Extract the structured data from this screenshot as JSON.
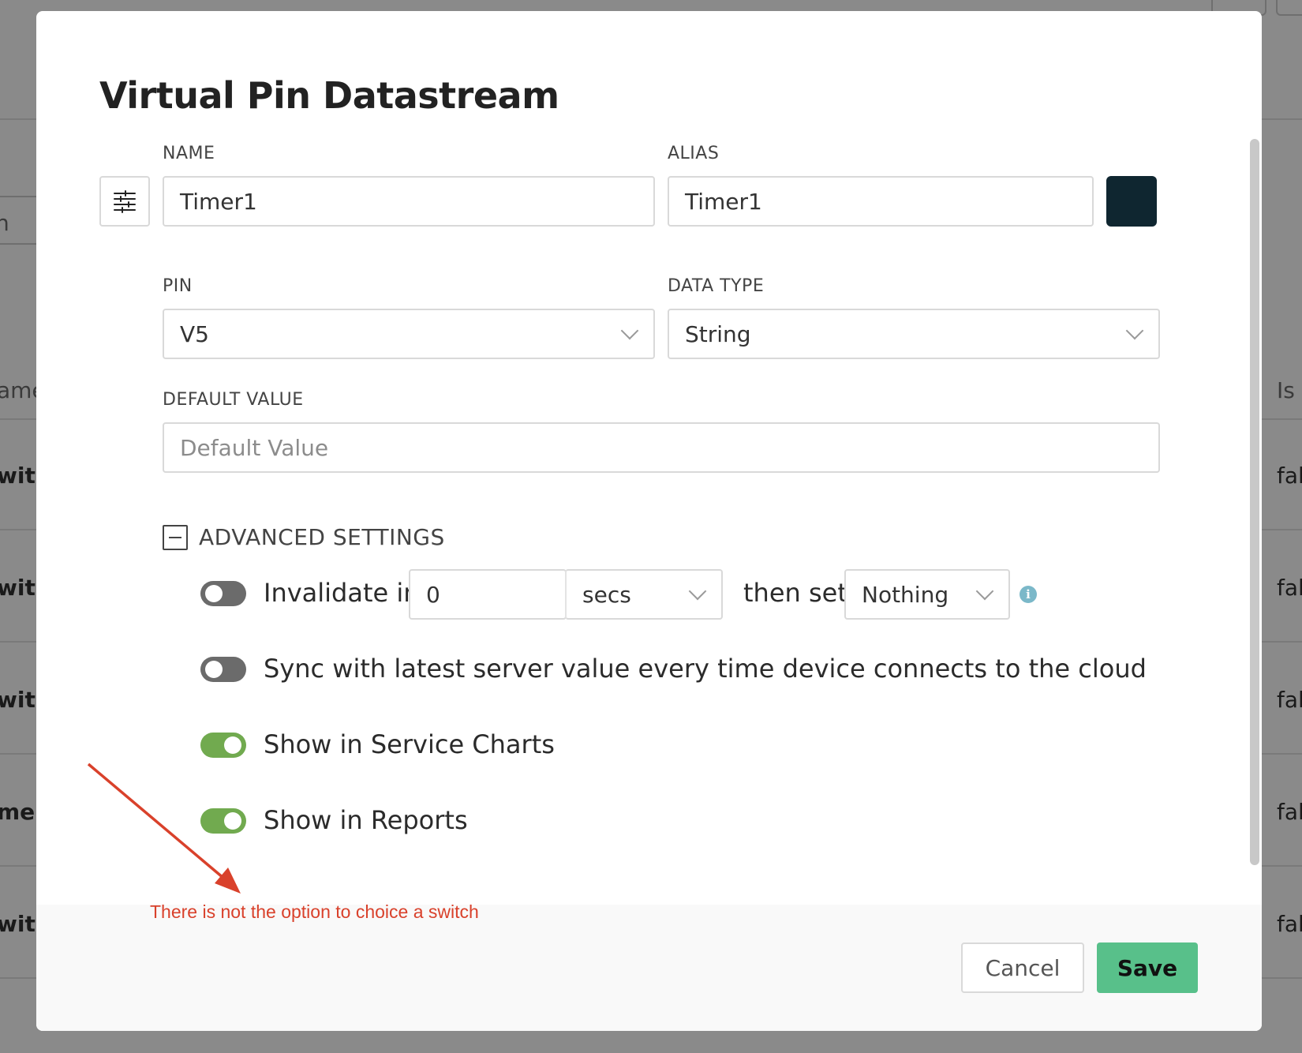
{
  "modal": {
    "title": "Virtual Pin Datastream",
    "name_label": "NAME",
    "name_value": "Timer1",
    "alias_label": "ALIAS",
    "alias_value": "Timer1",
    "color_swatch": "#0f2630",
    "pin_label": "PIN",
    "pin_value": "V5",
    "data_type_label": "DATA TYPE",
    "data_type_value": "String",
    "default_value_label": "DEFAULT VALUE",
    "default_value_placeholder": "Default Value",
    "advanced_settings_label": "ADVANCED SETTINGS"
  },
  "advanced": {
    "invalidate": {
      "enabled": false,
      "label": "Invalidate in",
      "value": "0",
      "unit": "secs",
      "then_label": "then set",
      "then_value": "Nothing"
    },
    "sync": {
      "enabled": false,
      "label": "Sync with latest server value every time device connects to the cloud"
    },
    "service_charts": {
      "enabled": true,
      "label": "Show in Service Charts"
    },
    "reports": {
      "enabled": true,
      "label": "Show in Reports"
    }
  },
  "footer": {
    "cancel_label": "Cancel",
    "save_label": "Save"
  },
  "annotation": {
    "text": "There is not the option to choice a switch",
    "color": "#d9412b"
  },
  "background": {
    "column_header_left": "ame",
    "column_header_right": "Is F",
    "search_fragment": "n",
    "rows": [
      {
        "left": "witc",
        "right": "fal"
      },
      {
        "left": "witc",
        "right": "fal"
      },
      {
        "left": "witc",
        "right": "fal"
      },
      {
        "left": "mer",
        "right": "fal"
      },
      {
        "left": "witc",
        "right": "fal"
      }
    ]
  },
  "colors": {
    "accent_green": "#58c08a",
    "toggle_on": "#71aa4f",
    "toggle_off": "#6b6b6b",
    "info": "#7bb8c9"
  }
}
